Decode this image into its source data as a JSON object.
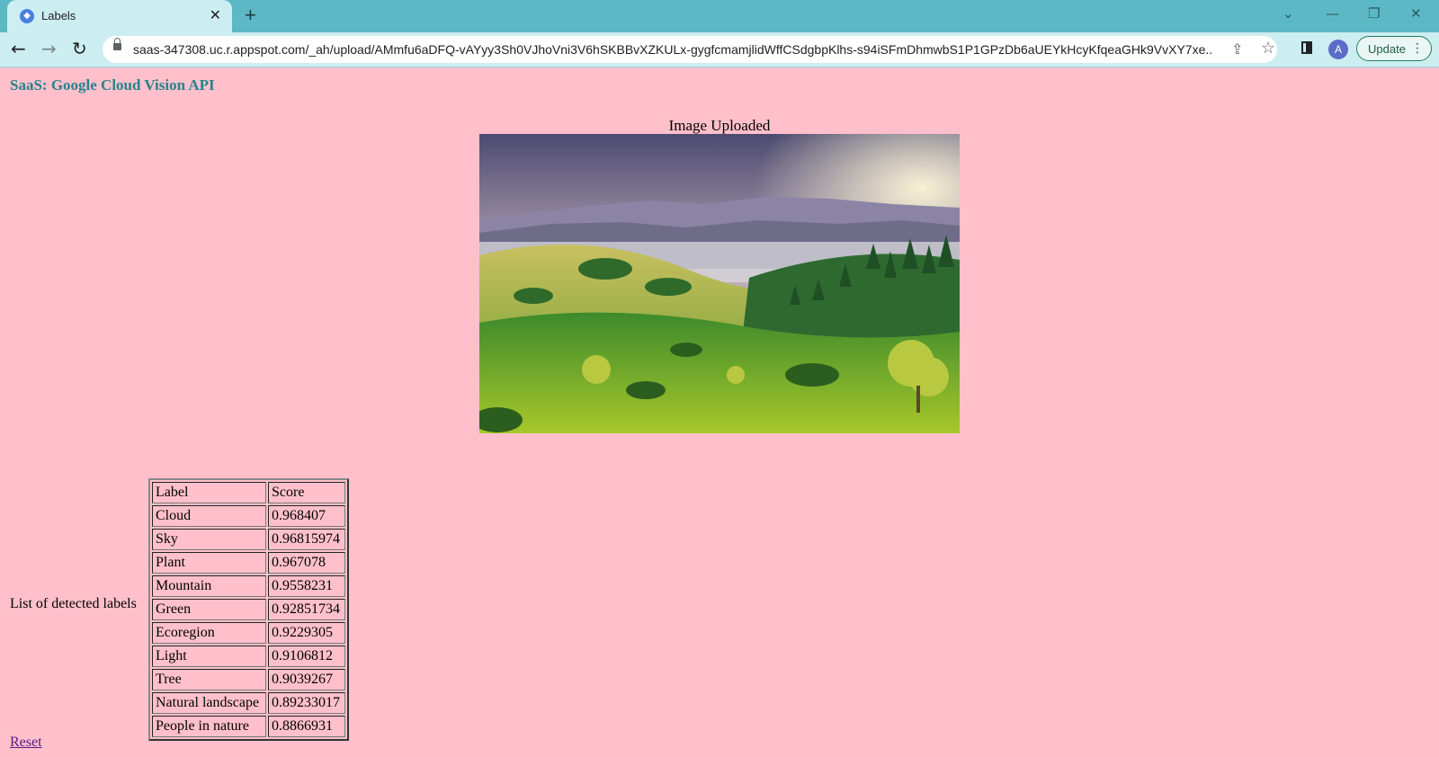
{
  "browser": {
    "tab_title": "Labels",
    "url": "saas-347308.uc.r.appspot.com/_ah/upload/AMmfu6aDFQ-vAYyy3Sh0VJhoVni3V6hSKBBvXZKULx-gygfcmamjlidWffCSdgbpKlhs-s94iSFmDhmwbS1P1GPzDb6aUEYkHcyKfqeaGHk9VvXY7xe...",
    "profile_initial": "A",
    "update_label": "Update"
  },
  "page": {
    "header": "SaaS: Google Cloud Vision API",
    "image_caption": "Image Uploaded",
    "labels_caption": "List of detected labels",
    "reset_label": "Reset"
  },
  "table": {
    "headers": [
      "Label",
      "Score"
    ],
    "rows": [
      [
        "Cloud",
        "0.968407"
      ],
      [
        "Sky",
        "0.96815974"
      ],
      [
        "Plant",
        "0.967078"
      ],
      [
        "Mountain",
        "0.9558231"
      ],
      [
        "Green",
        "0.92851734"
      ],
      [
        "Ecoregion",
        "0.9229305"
      ],
      [
        "Light",
        "0.9106812"
      ],
      [
        "Tree",
        "0.9039267"
      ],
      [
        "Natural landscape",
        "0.89233017"
      ],
      [
        "People in nature",
        "0.8866931"
      ]
    ]
  },
  "colors": {
    "page_background": "#ffc0cb",
    "header_text": "#24848d",
    "chrome": "#5cb8c4"
  },
  "icons": [
    "back-icon",
    "forward-icon",
    "reload-icon",
    "lock-icon",
    "share-icon",
    "star-icon",
    "side-panel-icon",
    "kebab-menu-icon",
    "close-icon",
    "plus-icon"
  ]
}
